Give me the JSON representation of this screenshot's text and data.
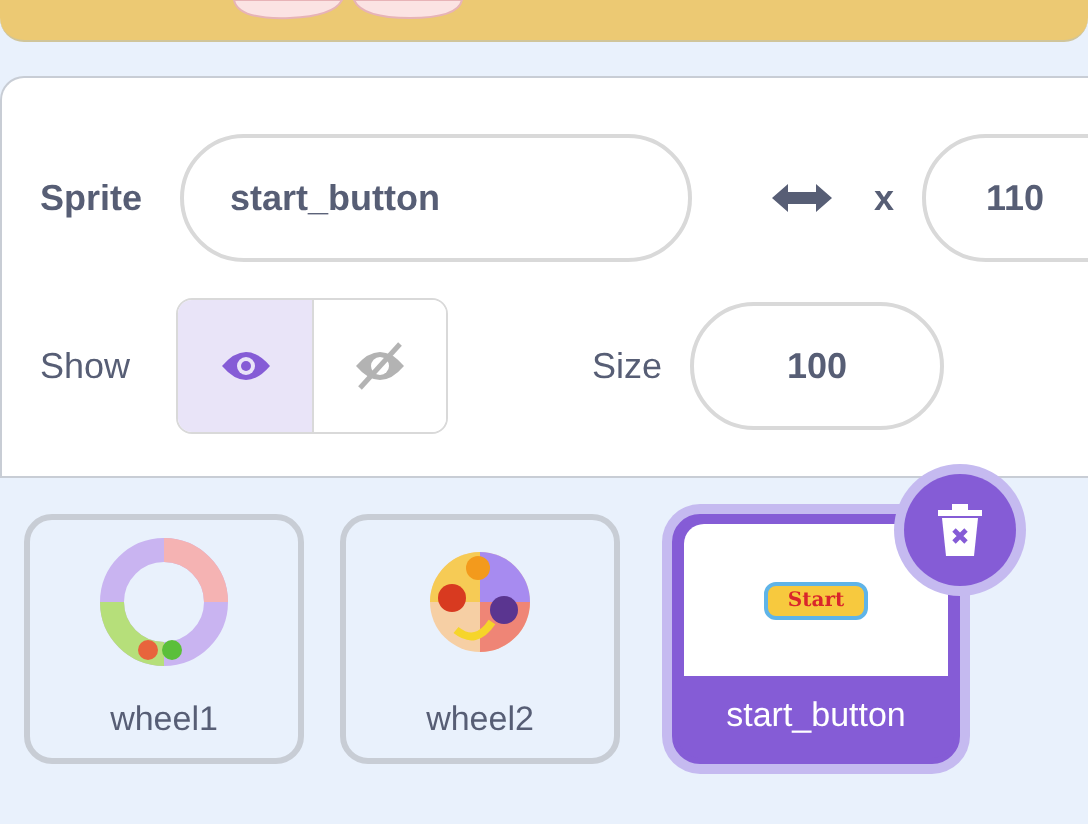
{
  "sprite_info": {
    "sprite_label": "Sprite",
    "sprite_name": "start_button",
    "x_label": "x",
    "x_value": "110",
    "show_label": "Show",
    "show_options": [
      {
        "kind": "visible",
        "selected": true
      },
      {
        "kind": "hidden",
        "selected": false
      }
    ],
    "size_label": "Size",
    "size_value": "100"
  },
  "sprites": [
    {
      "name": "wheel1",
      "kind": "ring",
      "selected": false
    },
    {
      "name": "wheel2",
      "kind": "plate",
      "selected": false
    },
    {
      "name": "start_button",
      "kind": "button",
      "thumbnail_text": "Start",
      "selected": true
    }
  ]
}
